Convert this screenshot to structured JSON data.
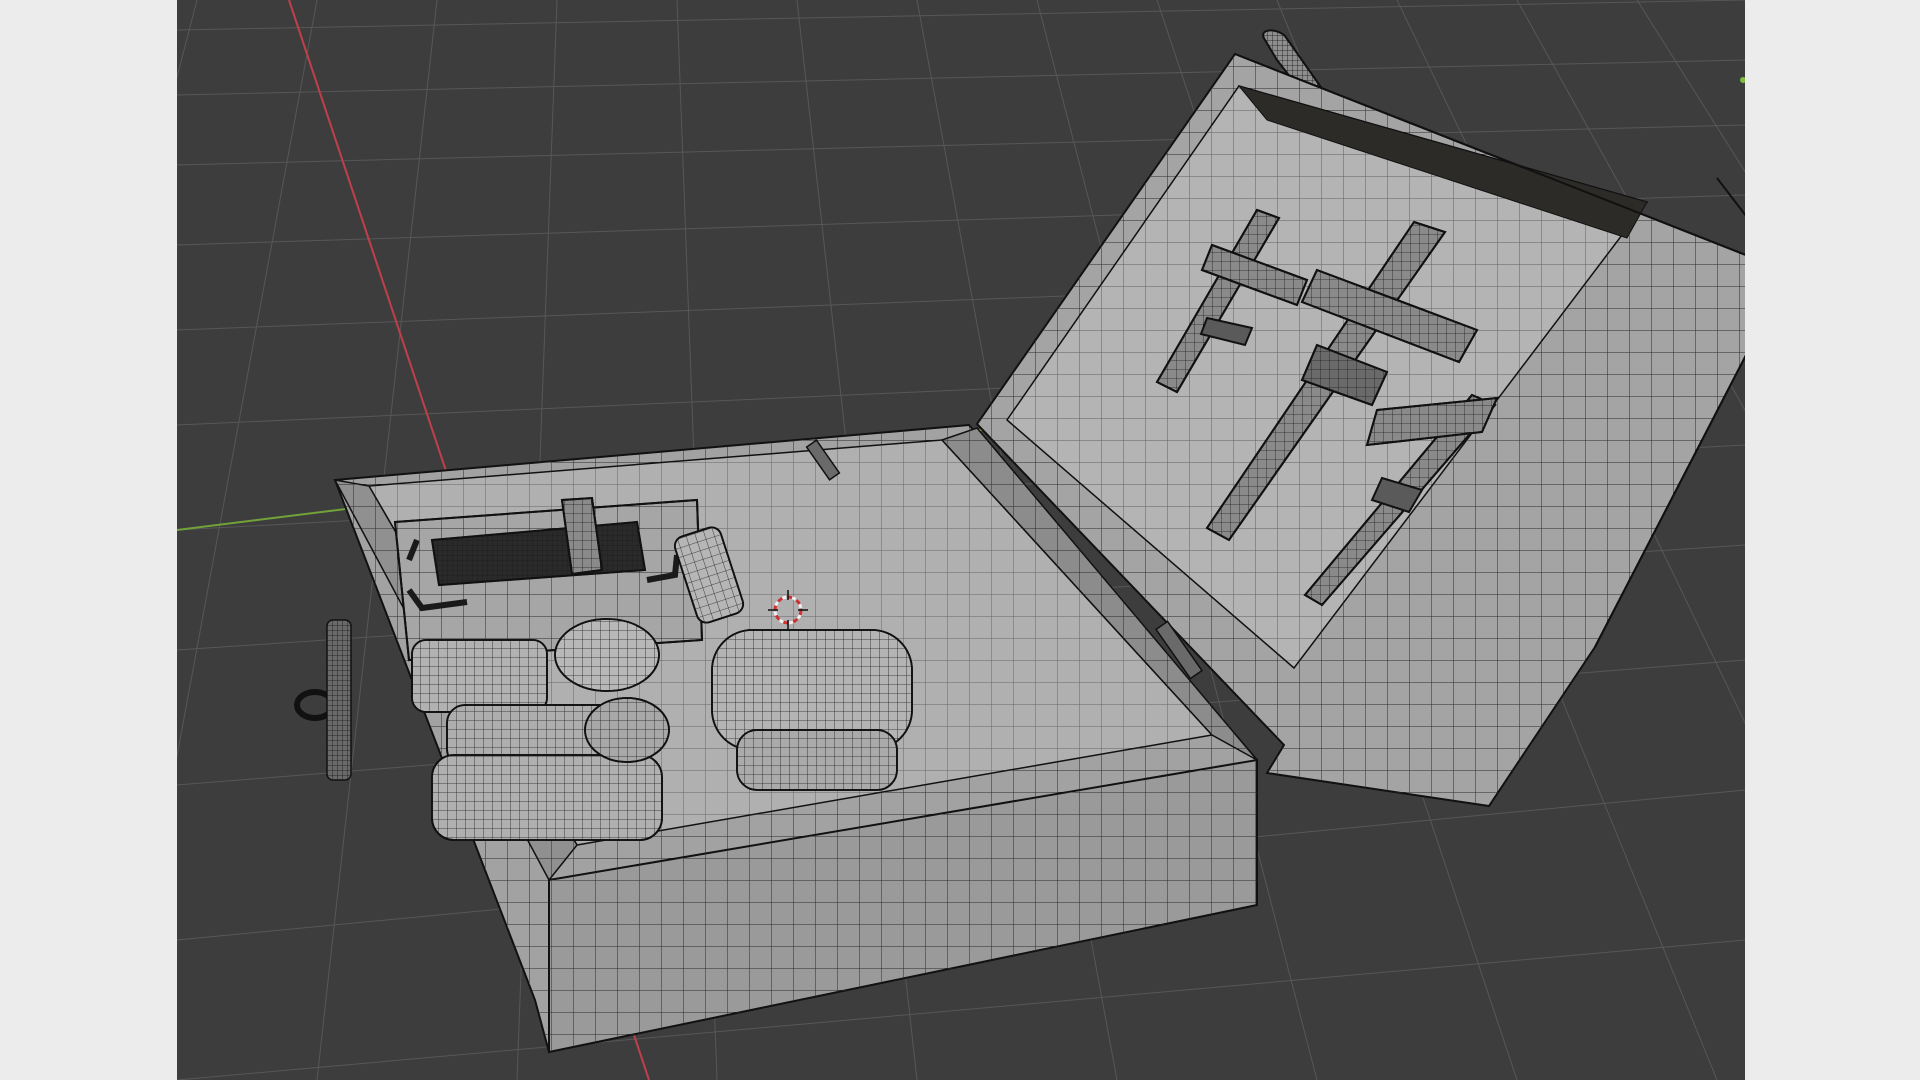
{
  "viewport": {
    "label": "3D Viewport",
    "shading": "wireframe",
    "background_color": "#3d3d3d",
    "grid_color": "#575757",
    "x_axis_color": "#c0404a",
    "y_axis_color": "#72a23a"
  },
  "scene": {
    "objects": [
      {
        "name": "chest-base",
        "type": "mesh"
      },
      {
        "name": "chest-lid",
        "type": "mesh"
      },
      {
        "name": "lid-tool-crosses",
        "type": "mesh"
      },
      {
        "name": "tray-with-bar",
        "type": "mesh"
      },
      {
        "name": "stacked-cylinder-parts",
        "type": "mesh"
      },
      {
        "name": "handle-strap",
        "type": "mesh"
      },
      {
        "name": "side-ring",
        "type": "mesh"
      }
    ],
    "mesh_fill_color": "#a9a9a9",
    "wire_color": "#1a1a1a",
    "cursor_color": "#d03030"
  }
}
